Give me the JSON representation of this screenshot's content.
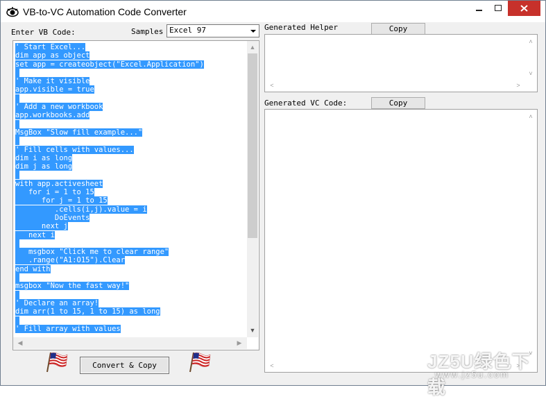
{
  "window": {
    "title": "VB-to-VC Automation Code Converter",
    "close_color": "#c7312b"
  },
  "left": {
    "enter_label": "Enter VB Code:",
    "samples_label": "Samples",
    "samples_value": "Excel 97",
    "code_lines": [
      "' Start Excel...",
      "dim app as object",
      "set app = createobject(\"Excel.Application\")",
      "",
      "' Make it visible",
      "app.visible = true",
      "",
      "' Add a new workbook",
      "app.workbooks.add",
      "",
      "MsgBox \"Slow fill example...\"",
      "",
      "' Fill cells with values...",
      "dim i as long",
      "dim j as long",
      "",
      "with app.activesheet",
      "   for i = 1 to 15",
      "      for j = 1 to 15",
      "         .cells(i,j).value = i",
      "         DoEvents",
      "      next j",
      "   next i",
      "",
      "   msgbox \"Click me to clear range\"",
      "   .range(\"A1:O15\").Clear",
      "end with",
      "",
      "msgbox \"Now the fast way!\"",
      "",
      "' Declare an array!",
      "dim arr(1 to 15, 1 to 15) as long",
      "",
      "' Fill array with values"
    ],
    "convert_label": "Convert & Copy"
  },
  "right": {
    "helper_label": "Generated Helper",
    "helper_copy": "Copy",
    "vc_label": "Generated VC Code:",
    "vc_copy": "Copy"
  },
  "watermark": {
    "main": "JZ5U绿色下载",
    "sub": "www.jz5u.com"
  }
}
